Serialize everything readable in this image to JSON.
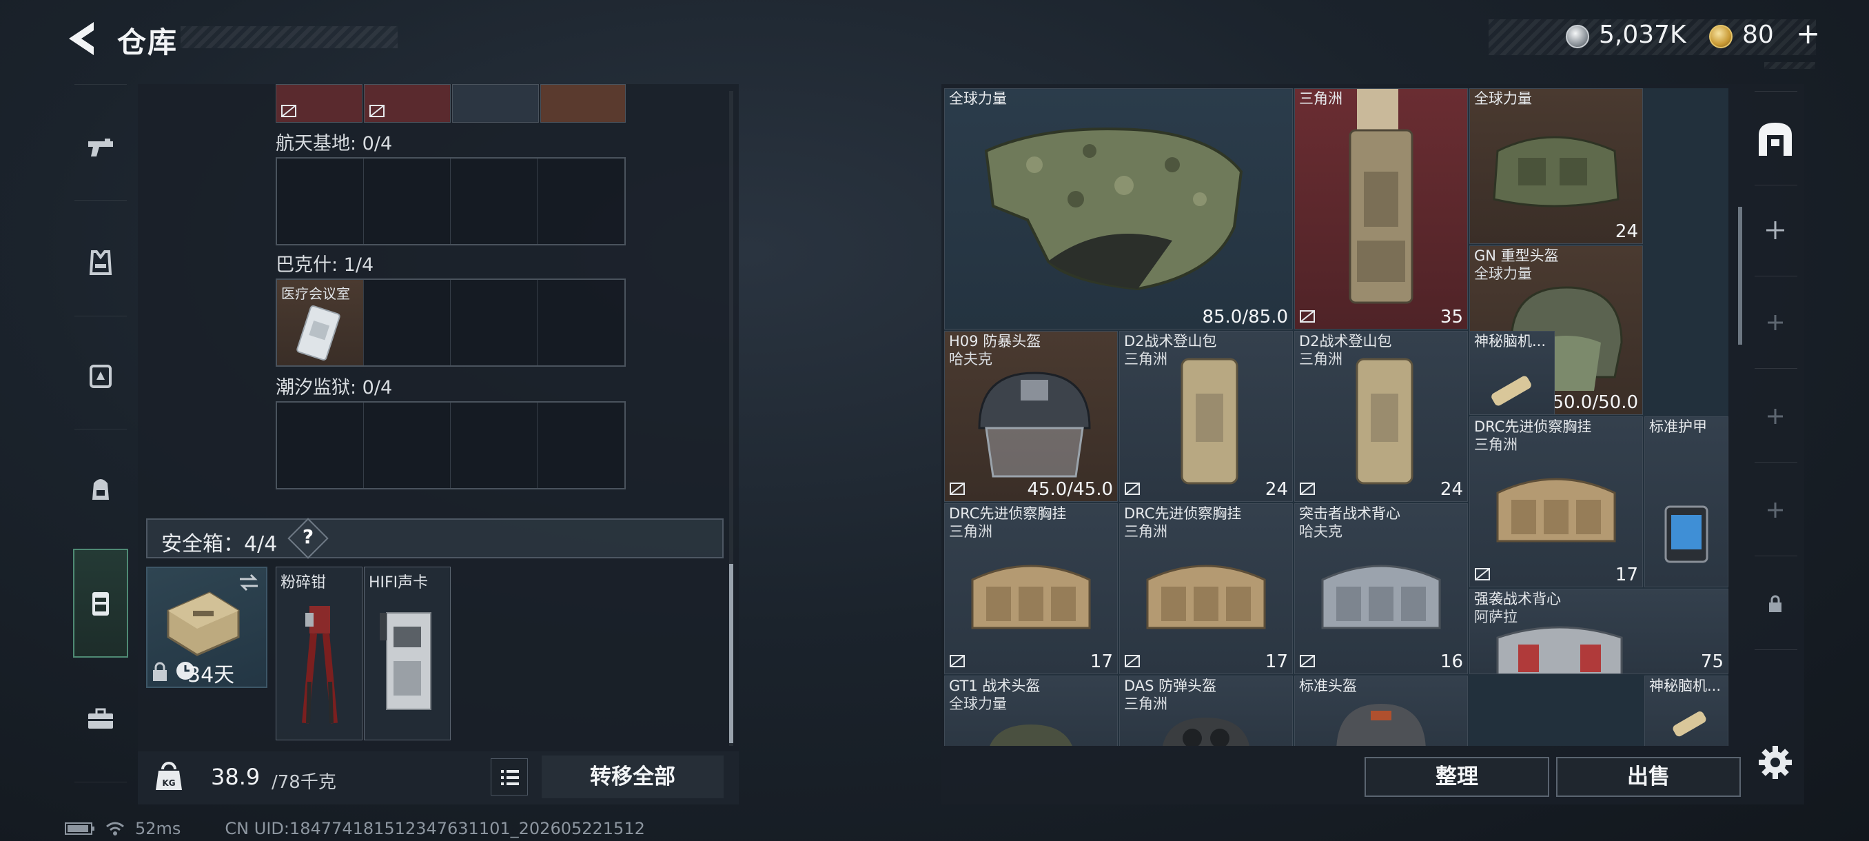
{
  "header": {
    "title": "仓库",
    "coins": "5,037K",
    "gems": "80",
    "gems_plus": "+"
  },
  "storage": {
    "zones": [
      {
        "label": "航天基地: 0/4"
      },
      {
        "label": "巴克什: 1/4",
        "items": [
          {
            "name": "医疗会议室"
          }
        ]
      },
      {
        "label": "潮汐监狱: 0/4"
      }
    ],
    "secure_box": {
      "label": "安全箱：4/4",
      "help": "?",
      "case_time": "34天",
      "slots": [
        {
          "name": "粉碎钳"
        },
        {
          "name": "HIFI声卡"
        }
      ]
    },
    "weight": "38.9",
    "weight_max": "/78千克",
    "transfer_all": "转移全部"
  },
  "status": {
    "ping": "52ms",
    "uid": "CN UID:184774181512347631101_202605221512"
  },
  "inventory": {
    "items": [
      {
        "name": "全球力量",
        "sub": "",
        "value": "85.0/85.0"
      },
      {
        "name": "三角洲",
        "sub": "",
        "value": "35"
      },
      {
        "name": "全球力量",
        "sub": "",
        "value": "24"
      },
      {
        "name": "GN 重型头盔",
        "sub": "全球力量",
        "value": "50.0/50.0"
      },
      {
        "name": "H09 防暴头盔",
        "sub": "哈夫克",
        "value": "45.0/45.0"
      },
      {
        "name": "D2战术登山包",
        "sub": "三角洲",
        "value": "24"
      },
      {
        "name": "D2战术登山包",
        "sub": "三角洲",
        "value": "24"
      },
      {
        "name": "神秘脑机...",
        "sub": "",
        "value": ""
      },
      {
        "name": "DRC先进侦察胸挂",
        "sub": "三角洲",
        "value": "17"
      },
      {
        "name": "标准护甲",
        "sub": "",
        "value": ""
      },
      {
        "name": "DRC先进侦察胸挂",
        "sub": "三角洲",
        "value": "17"
      },
      {
        "name": "DRC先进侦察胸挂",
        "sub": "三角洲",
        "value": "17"
      },
      {
        "name": "突击者战术背心",
        "sub": "哈夫克",
        "value": "16"
      },
      {
        "name": "强袭战术背心",
        "sub": "阿萨拉",
        "value": "75"
      },
      {
        "name": "GT1 战术头盔",
        "sub": "全球力量",
        "value": ""
      },
      {
        "name": "DAS 防弹头盔",
        "sub": "三角洲",
        "value": ""
      },
      {
        "name": "标准头盔",
        "sub": "",
        "value": ""
      },
      {
        "name": "神秘脑机...",
        "sub": "",
        "value": ""
      }
    ]
  },
  "actions": {
    "sort": "整理",
    "sell": "出售"
  },
  "colors": {
    "accent_green": "#4f8a74",
    "rarity_red": "#6a2d32",
    "rarity_blue": "#2b3c4b",
    "rarity_brown": "#4a3a30"
  }
}
